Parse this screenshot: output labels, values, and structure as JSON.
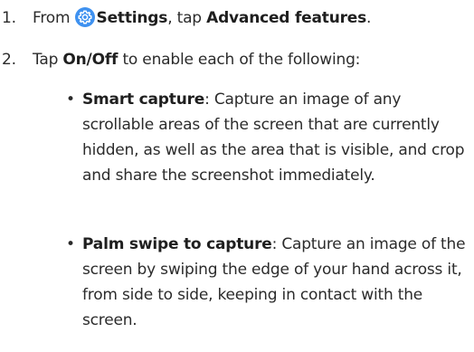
{
  "step1": {
    "number": "1.",
    "prefix": "From",
    "icon": "settings-gear-icon",
    "icon_color": "#3e91f0",
    "settings_label": "Settings",
    "middle": ", tap",
    "feature_label": "Advanced features",
    "suffix": "."
  },
  "step2": {
    "number": "2.",
    "prefix": "Tap",
    "toggle_label": "On/Off",
    "suffix": "to enable each of the following:"
  },
  "bullets": [
    {
      "title": "Smart capture",
      "description": ": Capture an image of any scrollable areas of the screen that are currently hidden, as well as the area that is visible, and crop and share the screenshot immediately."
    },
    {
      "title": "Palm swipe to capture",
      "description": ": Capture an image of the screen by swiping the edge of your hand across it, from side to side, keeping in contact with the screen."
    }
  ]
}
